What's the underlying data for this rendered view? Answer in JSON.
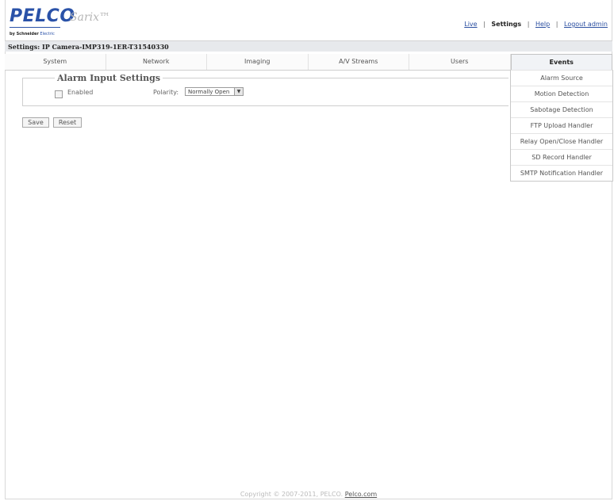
{
  "header": {
    "logo": "PELCO",
    "product": "Sarix™",
    "byline_brand": "by Schneider",
    "byline_rest": "Electric",
    "nav": [
      {
        "label": "Live",
        "active": false
      },
      {
        "label": "Settings",
        "active": true
      },
      {
        "label": "Help",
        "active": false
      },
      {
        "label": "Logout admin",
        "active": false
      }
    ],
    "separator": "|"
  },
  "device_title": "Settings: IP Camera-IMP319-1ER-T31540330",
  "tabs": [
    {
      "label": "System"
    },
    {
      "label": "Network"
    },
    {
      "label": "Imaging"
    },
    {
      "label": "A/V Streams"
    },
    {
      "label": "Users"
    },
    {
      "label": "Events",
      "active": true
    }
  ],
  "alarm_settings": {
    "title": "Alarm Input Settings",
    "enabled_label": "Enabled",
    "enabled_checked": false,
    "polarity_label": "Polarity:",
    "polarity_value": "Normally Open",
    "arrow_glyph": "▼"
  },
  "buttons": {
    "save": "Save",
    "reset": "Reset"
  },
  "events_menu": [
    "Alarm Source",
    "Motion Detection",
    "Sabotage Detection",
    "FTP Upload Handler",
    "Relay Open/Close Handler",
    "SD Record Handler",
    "SMTP Notification Handler"
  ],
  "footer": {
    "copyright": "Copyright © 2007-2011, PELCO.",
    "link": "Pelco.com"
  }
}
